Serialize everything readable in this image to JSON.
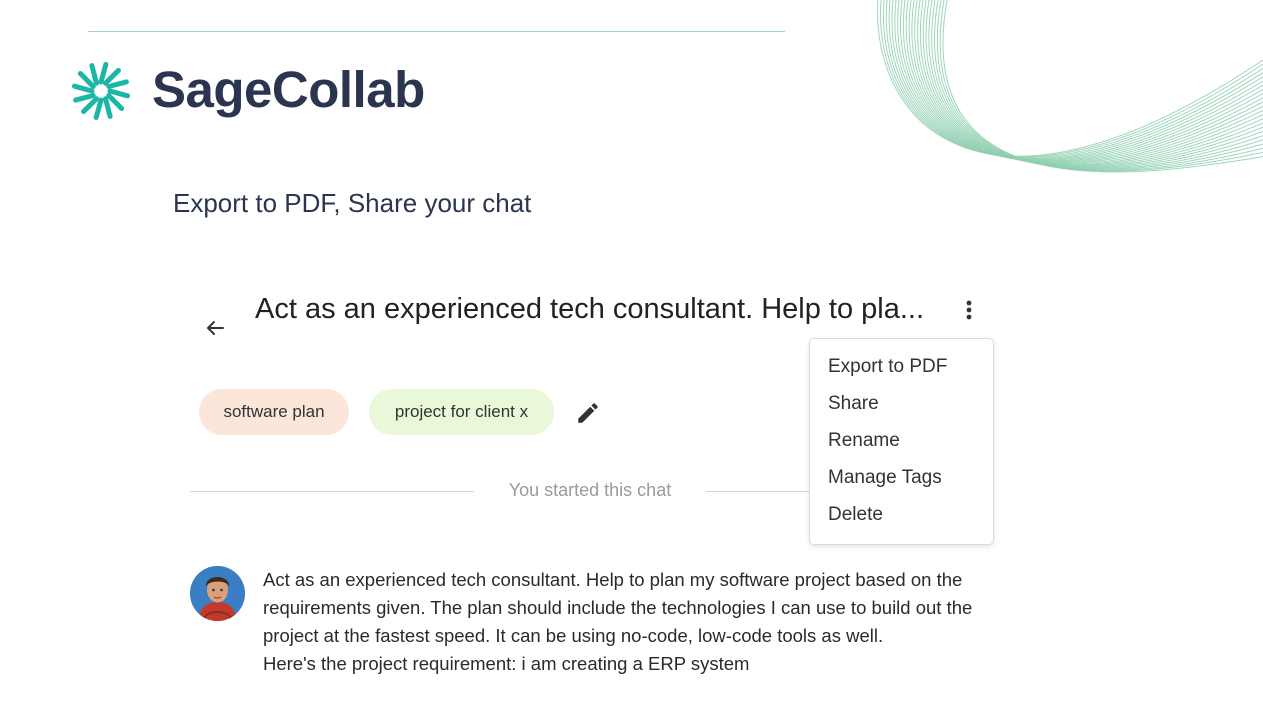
{
  "brand": {
    "name": "SageCollab",
    "accent": "#1bb6a5",
    "text_color": "#2b3550"
  },
  "subtitle": "Export to PDF, Share your chat",
  "chat": {
    "title": "Act as an experienced tech consultant. Help to pla...",
    "tags": [
      {
        "label": "software plan",
        "color": "#fbe6d9"
      },
      {
        "label": "project for client x",
        "color": "#e8f8d8"
      }
    ],
    "divider_text": "You started this chat",
    "message": {
      "paragraph": "Act as an experienced tech consultant. Help to plan my software project based on the requirements given. The plan should include the technologies I can use to build out the project at the fastest speed. It can be using no-code, low-code tools as well.",
      "next_line": "Here's the project requirement: i am creating a ERP system"
    }
  },
  "menu": {
    "items": [
      "Export to PDF",
      "Share",
      "Rename",
      "Manage Tags",
      "Delete"
    ]
  },
  "icons": {
    "back": "arrow-left-icon",
    "more": "more-vertical-icon",
    "edit": "pencil-icon",
    "logo": "sage-burst-logo-icon"
  }
}
